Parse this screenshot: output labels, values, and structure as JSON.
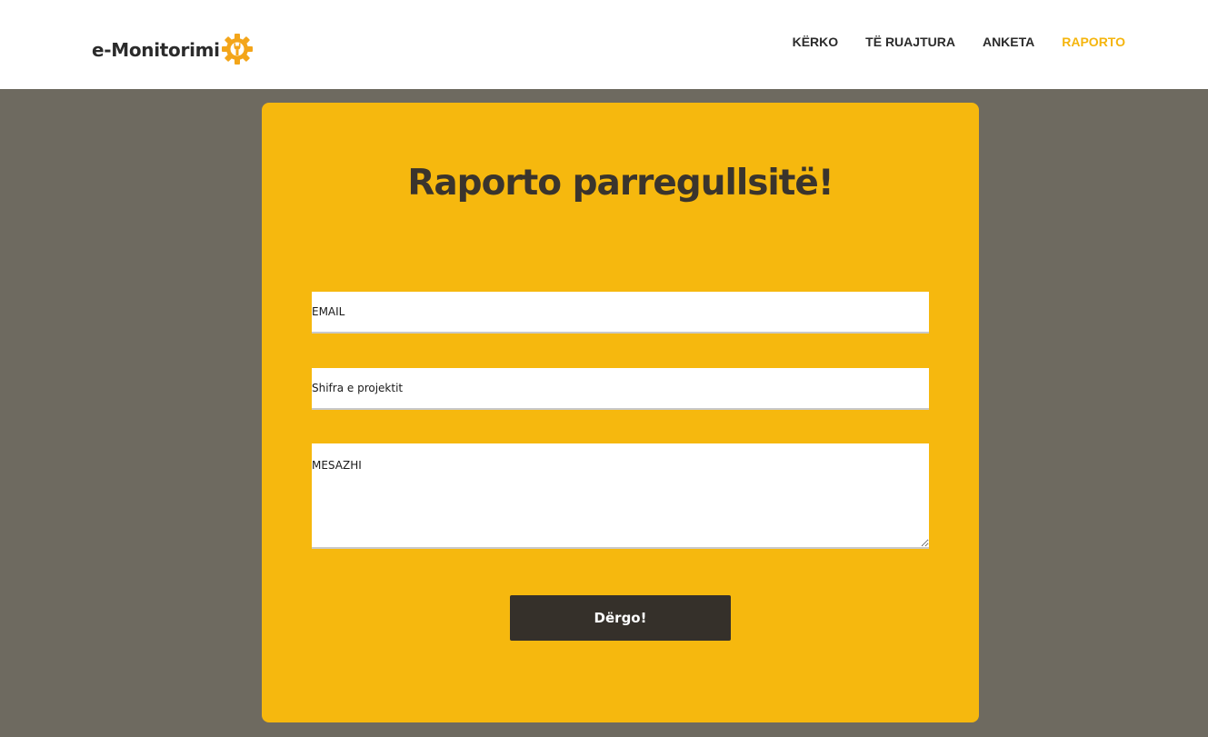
{
  "header": {
    "logo_text": "e-Monitorimi",
    "nav": [
      {
        "label": "KËRKO"
      },
      {
        "label": "TË RUAJTURA"
      },
      {
        "label": "ANKETA"
      },
      {
        "label": "RAPORTO",
        "active": true
      }
    ]
  },
  "form": {
    "title": "Raporto parregullsitë!",
    "email_placeholder": "EMAIL",
    "project_placeholder": "Shifra e projektit",
    "message_placeholder": "MESAZHI",
    "submit_label": "Dërgo!"
  },
  "colors": {
    "accent": "#f6b80e",
    "background": "#6e6a60",
    "button": "#35302a",
    "nav_active": "#f5b50d"
  },
  "icons": {
    "logo": "gear-wrench-icon"
  }
}
